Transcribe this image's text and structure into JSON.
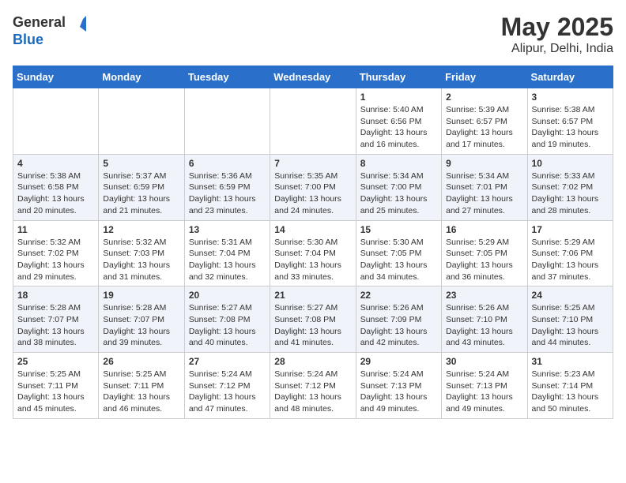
{
  "header": {
    "logo_general": "General",
    "logo_blue": "Blue",
    "title": "May 2025",
    "subtitle": "Alipur, Delhi, India"
  },
  "days_of_week": [
    "Sunday",
    "Monday",
    "Tuesday",
    "Wednesday",
    "Thursday",
    "Friday",
    "Saturday"
  ],
  "weeks": [
    [
      {
        "day": "",
        "info": ""
      },
      {
        "day": "",
        "info": ""
      },
      {
        "day": "",
        "info": ""
      },
      {
        "day": "",
        "info": ""
      },
      {
        "day": "1",
        "info": "Sunrise: 5:40 AM\nSunset: 6:56 PM\nDaylight: 13 hours and 16 minutes."
      },
      {
        "day": "2",
        "info": "Sunrise: 5:39 AM\nSunset: 6:57 PM\nDaylight: 13 hours and 17 minutes."
      },
      {
        "day": "3",
        "info": "Sunrise: 5:38 AM\nSunset: 6:57 PM\nDaylight: 13 hours and 19 minutes."
      }
    ],
    [
      {
        "day": "4",
        "info": "Sunrise: 5:38 AM\nSunset: 6:58 PM\nDaylight: 13 hours and 20 minutes."
      },
      {
        "day": "5",
        "info": "Sunrise: 5:37 AM\nSunset: 6:59 PM\nDaylight: 13 hours and 21 minutes."
      },
      {
        "day": "6",
        "info": "Sunrise: 5:36 AM\nSunset: 6:59 PM\nDaylight: 13 hours and 23 minutes."
      },
      {
        "day": "7",
        "info": "Sunrise: 5:35 AM\nSunset: 7:00 PM\nDaylight: 13 hours and 24 minutes."
      },
      {
        "day": "8",
        "info": "Sunrise: 5:34 AM\nSunset: 7:00 PM\nDaylight: 13 hours and 25 minutes."
      },
      {
        "day": "9",
        "info": "Sunrise: 5:34 AM\nSunset: 7:01 PM\nDaylight: 13 hours and 27 minutes."
      },
      {
        "day": "10",
        "info": "Sunrise: 5:33 AM\nSunset: 7:02 PM\nDaylight: 13 hours and 28 minutes."
      }
    ],
    [
      {
        "day": "11",
        "info": "Sunrise: 5:32 AM\nSunset: 7:02 PM\nDaylight: 13 hours and 29 minutes."
      },
      {
        "day": "12",
        "info": "Sunrise: 5:32 AM\nSunset: 7:03 PM\nDaylight: 13 hours and 31 minutes."
      },
      {
        "day": "13",
        "info": "Sunrise: 5:31 AM\nSunset: 7:04 PM\nDaylight: 13 hours and 32 minutes."
      },
      {
        "day": "14",
        "info": "Sunrise: 5:30 AM\nSunset: 7:04 PM\nDaylight: 13 hours and 33 minutes."
      },
      {
        "day": "15",
        "info": "Sunrise: 5:30 AM\nSunset: 7:05 PM\nDaylight: 13 hours and 34 minutes."
      },
      {
        "day": "16",
        "info": "Sunrise: 5:29 AM\nSunset: 7:05 PM\nDaylight: 13 hours and 36 minutes."
      },
      {
        "day": "17",
        "info": "Sunrise: 5:29 AM\nSunset: 7:06 PM\nDaylight: 13 hours and 37 minutes."
      }
    ],
    [
      {
        "day": "18",
        "info": "Sunrise: 5:28 AM\nSunset: 7:07 PM\nDaylight: 13 hours and 38 minutes."
      },
      {
        "day": "19",
        "info": "Sunrise: 5:28 AM\nSunset: 7:07 PM\nDaylight: 13 hours and 39 minutes."
      },
      {
        "day": "20",
        "info": "Sunrise: 5:27 AM\nSunset: 7:08 PM\nDaylight: 13 hours and 40 minutes."
      },
      {
        "day": "21",
        "info": "Sunrise: 5:27 AM\nSunset: 7:08 PM\nDaylight: 13 hours and 41 minutes."
      },
      {
        "day": "22",
        "info": "Sunrise: 5:26 AM\nSunset: 7:09 PM\nDaylight: 13 hours and 42 minutes."
      },
      {
        "day": "23",
        "info": "Sunrise: 5:26 AM\nSunset: 7:10 PM\nDaylight: 13 hours and 43 minutes."
      },
      {
        "day": "24",
        "info": "Sunrise: 5:25 AM\nSunset: 7:10 PM\nDaylight: 13 hours and 44 minutes."
      }
    ],
    [
      {
        "day": "25",
        "info": "Sunrise: 5:25 AM\nSunset: 7:11 PM\nDaylight: 13 hours and 45 minutes."
      },
      {
        "day": "26",
        "info": "Sunrise: 5:25 AM\nSunset: 7:11 PM\nDaylight: 13 hours and 46 minutes."
      },
      {
        "day": "27",
        "info": "Sunrise: 5:24 AM\nSunset: 7:12 PM\nDaylight: 13 hours and 47 minutes."
      },
      {
        "day": "28",
        "info": "Sunrise: 5:24 AM\nSunset: 7:12 PM\nDaylight: 13 hours and 48 minutes."
      },
      {
        "day": "29",
        "info": "Sunrise: 5:24 AM\nSunset: 7:13 PM\nDaylight: 13 hours and 49 minutes."
      },
      {
        "day": "30",
        "info": "Sunrise: 5:24 AM\nSunset: 7:13 PM\nDaylight: 13 hours and 49 minutes."
      },
      {
        "day": "31",
        "info": "Sunrise: 5:23 AM\nSunset: 7:14 PM\nDaylight: 13 hours and 50 minutes."
      }
    ]
  ]
}
